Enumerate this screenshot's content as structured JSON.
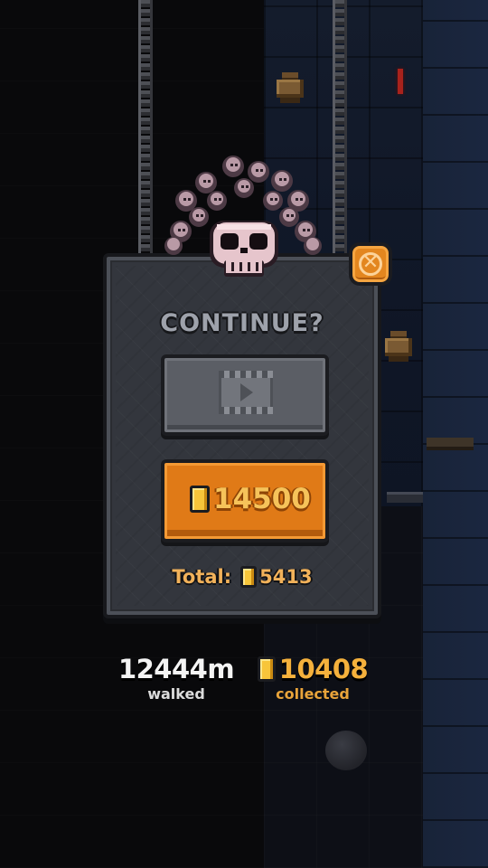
{
  "dialog": {
    "title": "CONTINUE?",
    "watch_video_icon": "film-play-icon",
    "coin_cost": "14500",
    "total_label": "Total:",
    "total_value": "5413",
    "close_icon": "close-x-icon"
  },
  "stats": {
    "distance_value": "12444m",
    "distance_label": "walked",
    "coins_value": "10408",
    "coins_label": "collected"
  },
  "colors": {
    "accent_orange": "#e07a17",
    "coin_gold": "#f7c53a",
    "panel_gray": "#33363d"
  }
}
